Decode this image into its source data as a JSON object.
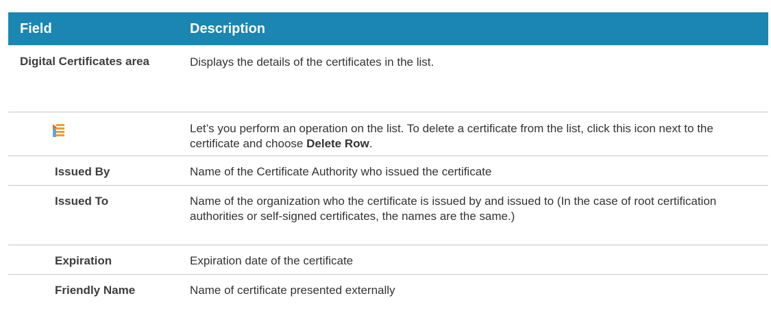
{
  "table": {
    "header": {
      "field": "Field",
      "description": "Description"
    },
    "rows": {
      "area": {
        "field": "Digital Certificates area",
        "description": "Displays the details of the certificates in the list."
      },
      "icon": {
        "icon": "row-menu-icon",
        "description_before": "Let’s you perform an operation on the list. To delete a certificate from the list, click this icon next to the certificate and choose ",
        "description_bold": "Delete Row",
        "description_after": "."
      },
      "issued_by": {
        "field": "Issued By",
        "description": "Name of the Certificate Authority who issued the certificate"
      },
      "issued_to": {
        "field": "Issued To",
        "description": "Name of the organization who the certificate is issued by and issued to (In the case of root certification authorities or self-signed certificates, the names are the same.)"
      },
      "expiration": {
        "field": "Expiration",
        "description": "Expiration date of the certificate"
      },
      "friendly_name": {
        "field": "Friendly Name",
        "description": "Name of certificate presented externally"
      }
    }
  },
  "colors": {
    "header_bg": "#1b86b1",
    "header_text": "#ffffff",
    "divider": "#c8c8c8"
  }
}
